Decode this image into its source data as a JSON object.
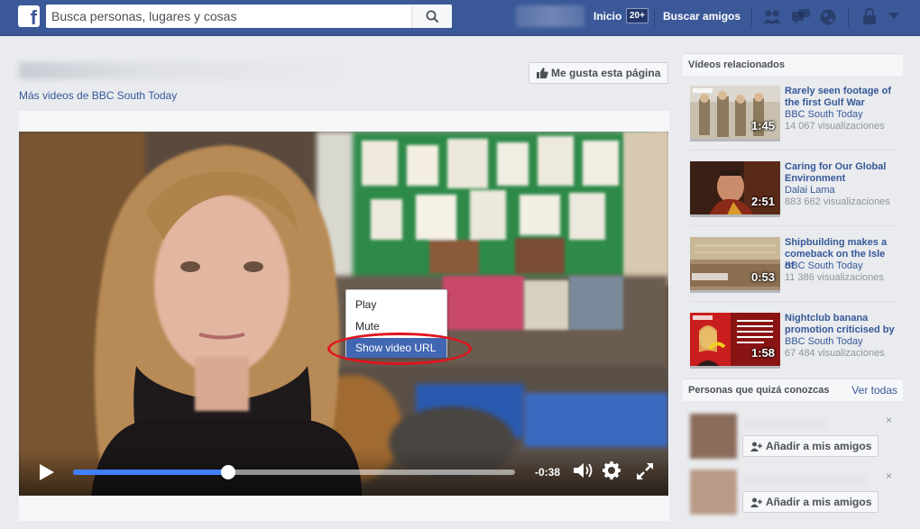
{
  "topbar": {
    "logo": "f",
    "search_placeholder": "Busca personas, lugares y cosas",
    "home_label": "Inicio",
    "home_count": "20+",
    "find_friends_label": "Buscar amigos",
    "icons": [
      "friend-requests-icon",
      "messages-icon",
      "notifications-globe-icon",
      "privacy-lock-icon",
      "account-menu-chevron-icon"
    ]
  },
  "page": {
    "more_videos_link": "Más videos de BBC South Today",
    "like_page_button": "Me gusta esta página"
  },
  "player": {
    "time_remaining": "-0:38",
    "progress_fraction": 0.35,
    "context_menu": {
      "items": [
        {
          "label": "Play"
        },
        {
          "label": "Mute"
        },
        {
          "label": "Show video URL",
          "highlighted": true
        }
      ],
      "annotation_color": "#e0141e"
    }
  },
  "sidebar": {
    "related_header": "Vídeos relacionados",
    "related": [
      {
        "title": "Rarely seen footage of the first Gulf War",
        "channel": "BBC South Today",
        "views": "14 067 visualizaciones",
        "duration": "1:45"
      },
      {
        "title": "Caring for Our Global Environment",
        "channel": "Dalai Lama",
        "views": "883 662 visualizaciones",
        "duration": "2:51"
      },
      {
        "title": "Shipbuilding makes a comeback on the Isle of",
        "channel": "BBC South Today",
        "views": "11 386 visualizaciones",
        "duration": "0:53"
      },
      {
        "title": "Nightclub banana promotion criticised by",
        "channel": "BBC South Today",
        "views": "67 484 visualizaciones",
        "duration": "1:58"
      }
    ],
    "people_header": "Personas que quizá conozcas",
    "people_see_all": "Ver todas",
    "people": [
      {
        "add_label": "Añadir a mis amigos",
        "close": "×"
      },
      {
        "add_label": "Añadir a mis amigos",
        "close": "×"
      }
    ]
  },
  "colors": {
    "brand": "#3b5998",
    "link": "#365899",
    "progress": "#4080ff"
  }
}
